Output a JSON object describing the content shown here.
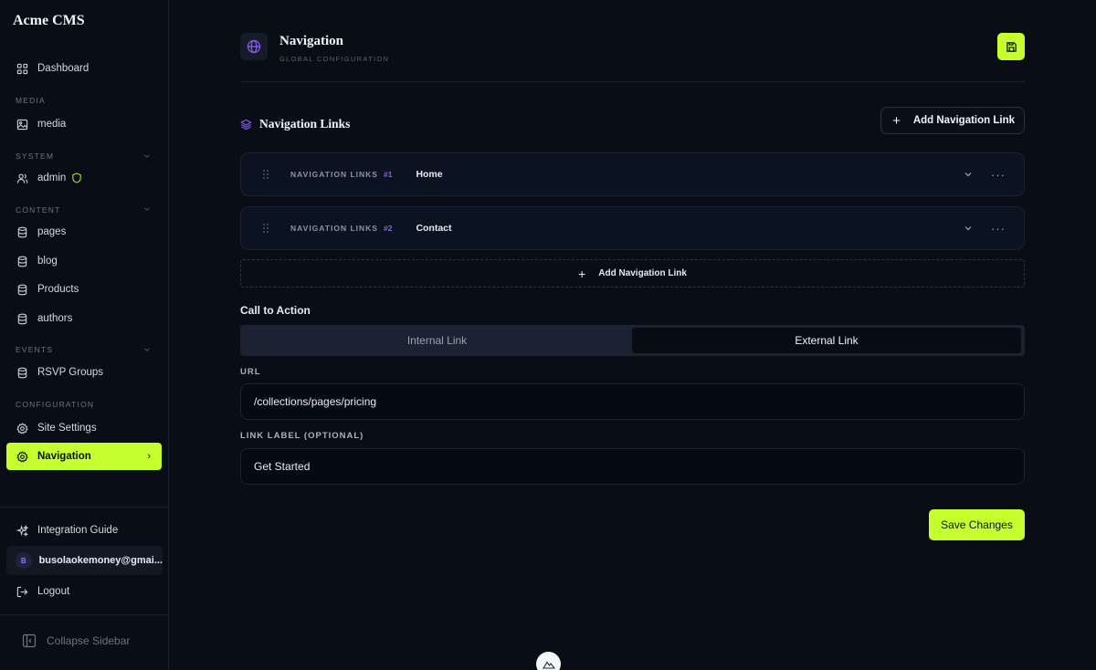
{
  "sidebar": {
    "brand": "Acme CMS",
    "dashboard": "Dashboard",
    "sections": {
      "media": "MEDIA",
      "system": "SYSTEM",
      "content": "CONTENT",
      "events": "EVENTS",
      "configuration": "CONFIGURATION"
    },
    "items": {
      "media": "media",
      "admin": "admin",
      "pages": "pages",
      "blog": "blog",
      "products": "Products",
      "authors": "authors",
      "rsvp": "RSVP Groups",
      "site_settings": "Site Settings",
      "navigation": "Navigation"
    },
    "integration_guide": "Integration Guide",
    "user": {
      "initial": "B",
      "email": "busolaokemoney@gmai..."
    },
    "logout": "Logout",
    "collapse": "Collapse Sidebar",
    "accent": "#c6ff2e"
  },
  "header": {
    "title": "Navigation",
    "subtitle": "GLOBAL CONFIGURATION"
  },
  "nav_links": {
    "title": "Navigation Links",
    "add_label": "Add Navigation Link",
    "rows": [
      {
        "label": "NAVIGATION LINKS",
        "num": "#1",
        "name": "Home"
      },
      {
        "label": "NAVIGATION LINKS",
        "num": "#2",
        "name": "Contact"
      }
    ],
    "add_dashed_label": "Add Navigation Link"
  },
  "cta": {
    "title": "Call to Action",
    "options": {
      "internal": "Internal Link",
      "external": "External Link"
    },
    "selected": "External Link",
    "url_label": "URL",
    "url_value": "/collections/pages/pricing",
    "link_label_label": "LINK LABEL (OPTIONAL)",
    "link_label_value": "Get Started"
  },
  "save_changes": "Save Changes"
}
